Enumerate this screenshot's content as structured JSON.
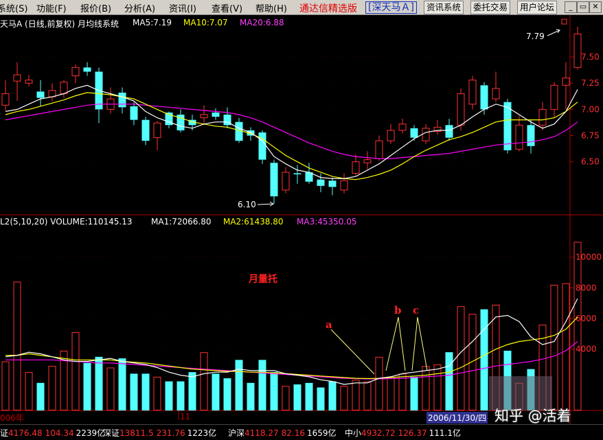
{
  "menu": {
    "items": [
      {
        "label": "系统(S)",
        "x": -4
      },
      {
        "label": "功能(F)",
        "x": 53
      },
      {
        "label": "报价(B)",
        "x": 117
      },
      {
        "label": "分析(A)",
        "x": 181
      },
      {
        "label": "资讯(I)",
        "x": 246
      },
      {
        "label": "查看(V)",
        "x": 308
      },
      {
        "label": "帮助(H)",
        "x": 372
      }
    ],
    "brand": "通达信精选版",
    "stock_selector": "[深天马Ａ]",
    "buttons": [
      "资讯系统",
      "委托交易",
      "用户论坛"
    ]
  },
  "price_panel": {
    "title": "天马A (日线,前复权) 月均线系统",
    "ma5": "MA5:7.19",
    "ma10": "MA10:7.07",
    "ma20": "MA20:6.88",
    "high_label": "7.79",
    "low_label": "6.10",
    "y_ticks": [
      "7.50",
      "7.25",
      "7.00",
      "6.75",
      "6.50"
    ]
  },
  "volume_panel": {
    "title": "L2(5,10,20) VOLUME:110145.13",
    "ma1": "MA1:72066.80",
    "ma2": "MA2:61438.80",
    "ma3": "MA3:45350.05",
    "annotation": "月量托",
    "marker_a": "a",
    "marker_b": "b",
    "marker_c": "c",
    "y_ticks": [
      "10000",
      "8000",
      "6000",
      "4000"
    ]
  },
  "time_axis": {
    "labels": [
      "006年",
      "11"
    ],
    "date_readout": "2006/11/30/四"
  },
  "colors": {
    "up": "#ff3232",
    "down": "#54ffff",
    "ma_white": "#ffffff",
    "ma_yellow": "#ffff00",
    "ma_purple": "#ff00ff",
    "grid": "#b00000"
  },
  "status": {
    "indices": [
      {
        "name": "证",
        "value": "4176.48",
        "chg": "104.34",
        "amount": "2239亿"
      },
      {
        "name": "深证",
        "value": "13811.5",
        "chg": "231.76",
        "amount": "1223亿"
      },
      {
        "name": "沪深",
        "value": "4118.27",
        "chg": "82.16",
        "amount": "1659亿"
      },
      {
        "name": "中小",
        "value": "4932.72",
        "chg": "126.37",
        "amount": "111.1亿"
      }
    ]
  },
  "watermark": "知乎 @活着",
  "chart_data": {
    "type": "candlestick",
    "title": "天马A (日线,前复权) 月均线系统",
    "candles": [
      {
        "o": 7.04,
        "c": 7.15,
        "h": 7.28,
        "l": 6.99
      },
      {
        "o": 7.27,
        "c": 7.33,
        "h": 7.45,
        "l": 7.08
      },
      {
        "o": 7.25,
        "c": 7.28,
        "h": 7.33,
        "l": 7.22
      },
      {
        "o": 7.17,
        "c": 7.11,
        "h": 7.28,
        "l": 7.03
      },
      {
        "o": 7.12,
        "c": 7.18,
        "h": 7.25,
        "l": 7.08
      },
      {
        "o": 7.15,
        "c": 7.26,
        "h": 7.28,
        "l": 7.11
      },
      {
        "o": 7.32,
        "c": 7.4,
        "h": 7.43,
        "l": 7.25
      },
      {
        "o": 7.4,
        "c": 7.36,
        "h": 7.45,
        "l": 7.32
      },
      {
        "o": 7.36,
        "c": 7.0,
        "h": 7.4,
        "l": 6.87
      },
      {
        "o": 7.0,
        "c": 7.1,
        "h": 7.21,
        "l": 6.96
      },
      {
        "o": 7.16,
        "c": 7.02,
        "h": 7.21,
        "l": 6.96
      },
      {
        "o": 7.03,
        "c": 6.9,
        "h": 7.07,
        "l": 6.85
      },
      {
        "o": 6.9,
        "c": 6.7,
        "h": 6.93,
        "l": 6.66
      },
      {
        "o": 6.73,
        "c": 6.87,
        "h": 6.89,
        "l": 6.61
      },
      {
        "o": 6.97,
        "c": 6.85,
        "h": 6.98,
        "l": 6.82
      },
      {
        "o": 6.95,
        "c": 6.8,
        "h": 7.0,
        "l": 6.78
      },
      {
        "o": 6.9,
        "c": 6.85,
        "h": 6.95,
        "l": 6.8
      },
      {
        "o": 6.92,
        "c": 6.95,
        "h": 7.04,
        "l": 6.85
      },
      {
        "o": 6.97,
        "c": 6.93,
        "h": 7.01,
        "l": 6.9
      },
      {
        "o": 6.95,
        "c": 6.85,
        "h": 7.02,
        "l": 6.82
      },
      {
        "o": 6.88,
        "c": 6.7,
        "h": 6.92,
        "l": 6.68
      },
      {
        "o": 6.8,
        "c": 6.75,
        "h": 6.83,
        "l": 6.7
      },
      {
        "o": 6.78,
        "c": 6.52,
        "h": 6.8,
        "l": 6.48
      },
      {
        "o": 6.49,
        "c": 6.17,
        "h": 6.52,
        "l": 6.1
      },
      {
        "o": 6.23,
        "c": 6.4,
        "h": 6.45,
        "l": 6.2
      },
      {
        "o": 6.39,
        "c": 6.38,
        "h": 6.47,
        "l": 6.29
      },
      {
        "o": 6.4,
        "c": 6.31,
        "h": 6.49,
        "l": 6.29
      },
      {
        "o": 6.33,
        "c": 6.27,
        "h": 6.39,
        "l": 6.21
      },
      {
        "o": 6.32,
        "c": 6.26,
        "h": 6.35,
        "l": 6.18
      },
      {
        "o": 6.23,
        "c": 6.32,
        "h": 6.39,
        "l": 6.2
      },
      {
        "o": 6.39,
        "c": 6.5,
        "h": 6.57,
        "l": 6.37
      },
      {
        "o": 6.49,
        "c": 6.52,
        "h": 6.6,
        "l": 6.43
      },
      {
        "o": 6.53,
        "c": 6.7,
        "h": 6.75,
        "l": 6.51
      },
      {
        "o": 6.7,
        "c": 6.8,
        "h": 6.86,
        "l": 6.67
      },
      {
        "o": 6.8,
        "c": 6.86,
        "h": 6.91,
        "l": 6.77
      },
      {
        "o": 6.82,
        "c": 6.73,
        "h": 6.85,
        "l": 6.7
      },
      {
        "o": 6.7,
        "c": 6.82,
        "h": 6.86,
        "l": 6.67
      },
      {
        "o": 6.79,
        "c": 6.83,
        "h": 6.9,
        "l": 6.76
      },
      {
        "o": 6.85,
        "c": 6.73,
        "h": 6.91,
        "l": 6.7
      },
      {
        "o": 6.85,
        "c": 7.15,
        "h": 7.2,
        "l": 6.8
      },
      {
        "o": 7.05,
        "c": 7.28,
        "h": 7.32,
        "l": 7.0
      },
      {
        "o": 7.23,
        "c": 7.0,
        "h": 7.26,
        "l": 6.95
      },
      {
        "o": 7.1,
        "c": 7.2,
        "h": 7.36,
        "l": 7.07
      },
      {
        "o": 7.07,
        "c": 6.61,
        "h": 7.1,
        "l": 6.58
      },
      {
        "o": 6.62,
        "c": 6.85,
        "h": 6.94,
        "l": 6.6
      },
      {
        "o": 6.85,
        "c": 6.65,
        "h": 6.9,
        "l": 6.58
      },
      {
        "o": 6.85,
        "c": 7.0,
        "h": 7.07,
        "l": 6.8
      },
      {
        "o": 7.0,
        "c": 7.23,
        "h": 7.26,
        "l": 6.92
      },
      {
        "o": 7.23,
        "c": 7.3,
        "h": 7.45,
        "l": 7.0
      },
      {
        "o": 7.4,
        "c": 7.72,
        "h": 7.79,
        "l": 7.38
      }
    ],
    "ma5": [
      6.98,
      7.0,
      7.05,
      7.1,
      7.12,
      7.15,
      7.2,
      7.23,
      7.18,
      7.15,
      7.12,
      7.08,
      6.98,
      6.92,
      6.88,
      6.84,
      6.82,
      6.86,
      6.88,
      6.88,
      6.82,
      6.78,
      6.7,
      6.55,
      6.48,
      6.42,
      6.4,
      6.35,
      6.34,
      6.34,
      6.36,
      6.42,
      6.48,
      6.56,
      6.64,
      6.72,
      6.78,
      6.8,
      6.8,
      6.85,
      6.93,
      7.0,
      7.05,
      7.02,
      6.95,
      6.88,
      6.82,
      6.86,
      6.98,
      7.19
    ],
    "ma10": [
      6.95,
      6.98,
      7.0,
      7.03,
      7.06,
      7.09,
      7.13,
      7.16,
      7.15,
      7.14,
      7.12,
      7.1,
      7.05,
      7.0,
      6.95,
      6.92,
      6.88,
      6.86,
      6.84,
      6.83,
      6.8,
      6.77,
      6.72,
      6.64,
      6.56,
      6.5,
      6.44,
      6.4,
      6.36,
      6.34,
      6.33,
      6.35,
      6.38,
      6.42,
      6.48,
      6.55,
      6.61,
      6.66,
      6.71,
      6.74,
      6.78,
      6.83,
      6.88,
      6.9,
      6.9,
      6.9,
      6.9,
      6.92,
      6.98,
      7.07
    ],
    "ma20": [
      6.9,
      6.92,
      6.94,
      6.96,
      6.98,
      7.0,
      7.02,
      7.04,
      7.05,
      7.05,
      7.05,
      7.05,
      7.04,
      7.03,
      7.02,
      7.01,
      7.0,
      6.99,
      6.98,
      6.97,
      6.95,
      6.92,
      6.88,
      6.83,
      6.78,
      6.73,
      6.68,
      6.64,
      6.6,
      6.57,
      6.55,
      6.54,
      6.53,
      6.53,
      6.54,
      6.55,
      6.56,
      6.57,
      6.58,
      6.6,
      6.62,
      6.64,
      6.66,
      6.67,
      6.68,
      6.69,
      6.71,
      6.74,
      6.8,
      6.88
    ],
    "volume": [
      3200,
      8400,
      2500,
      1800,
      2900,
      3900,
      5100,
      3100,
      3500,
      2800,
      3400,
      2400,
      2400,
      2200,
      1900,
      1900,
      2500,
      3800,
      2400,
      2100,
      3300,
      1800,
      3300,
      2500,
      1600,
      1700,
      1800,
      1500,
      1900,
      1600,
      2000,
      1900,
      3500,
      2200,
      2400,
      2200,
      2900,
      3000,
      3800,
      6800,
      6300,
      6600,
      6900,
      3900,
      1800,
      2700,
      5600,
      8200,
      8300,
      11000
    ],
    "vol_ma1": [
      3500,
      3600,
      3800,
      3700,
      3500,
      3300,
      3200,
      3200,
      3300,
      3400,
      3200,
      3100,
      3000,
      2800,
      2500,
      2300,
      2200,
      2400,
      2500,
      2500,
      2700,
      2600,
      2600,
      2600,
      2400,
      2300,
      2200,
      2000,
      1900,
      1700,
      1800,
      1800,
      2100,
      2200,
      2400,
      2500,
      2600,
      2700,
      2900,
      3800,
      4500,
      5300,
      6100,
      6200,
      5800,
      4800,
      4300,
      4500,
      5800,
      7300
    ],
    "vol_ma2": [
      3600,
      3600,
      3700,
      3600,
      3500,
      3400,
      3300,
      3300,
      3300,
      3300,
      3200,
      3150,
      3100,
      3000,
      2900,
      2800,
      2700,
      2650,
      2600,
      2550,
      2550,
      2500,
      2500,
      2450,
      2400,
      2350,
      2300,
      2250,
      2200,
      2150,
      2100,
      2080,
      2100,
      2150,
      2200,
      2250,
      2300,
      2400,
      2500,
      2800,
      3200,
      3600,
      4000,
      4300,
      4500,
      4600,
      4700,
      4900,
      5300,
      6100
    ],
    "vol_ma3": [
      3300,
      3300,
      3300,
      3300,
      3300,
      3250,
      3200,
      3150,
      3100,
      3100,
      3050,
      3000,
      2950,
      2900,
      2850,
      2800,
      2750,
      2700,
      2650,
      2600,
      2550,
      2500,
      2450,
      2400,
      2350,
      2300,
      2250,
      2200,
      2150,
      2100,
      2080,
      2060,
      2060,
      2080,
      2100,
      2150,
      2200,
      2250,
      2300,
      2450,
      2600,
      2750,
      2900,
      3000,
      3100,
      3200,
      3350,
      3550,
      3900,
      4500
    ],
    "price_range": [
      6.0,
      7.9
    ],
    "volume_range": [
      0,
      12000
    ]
  }
}
